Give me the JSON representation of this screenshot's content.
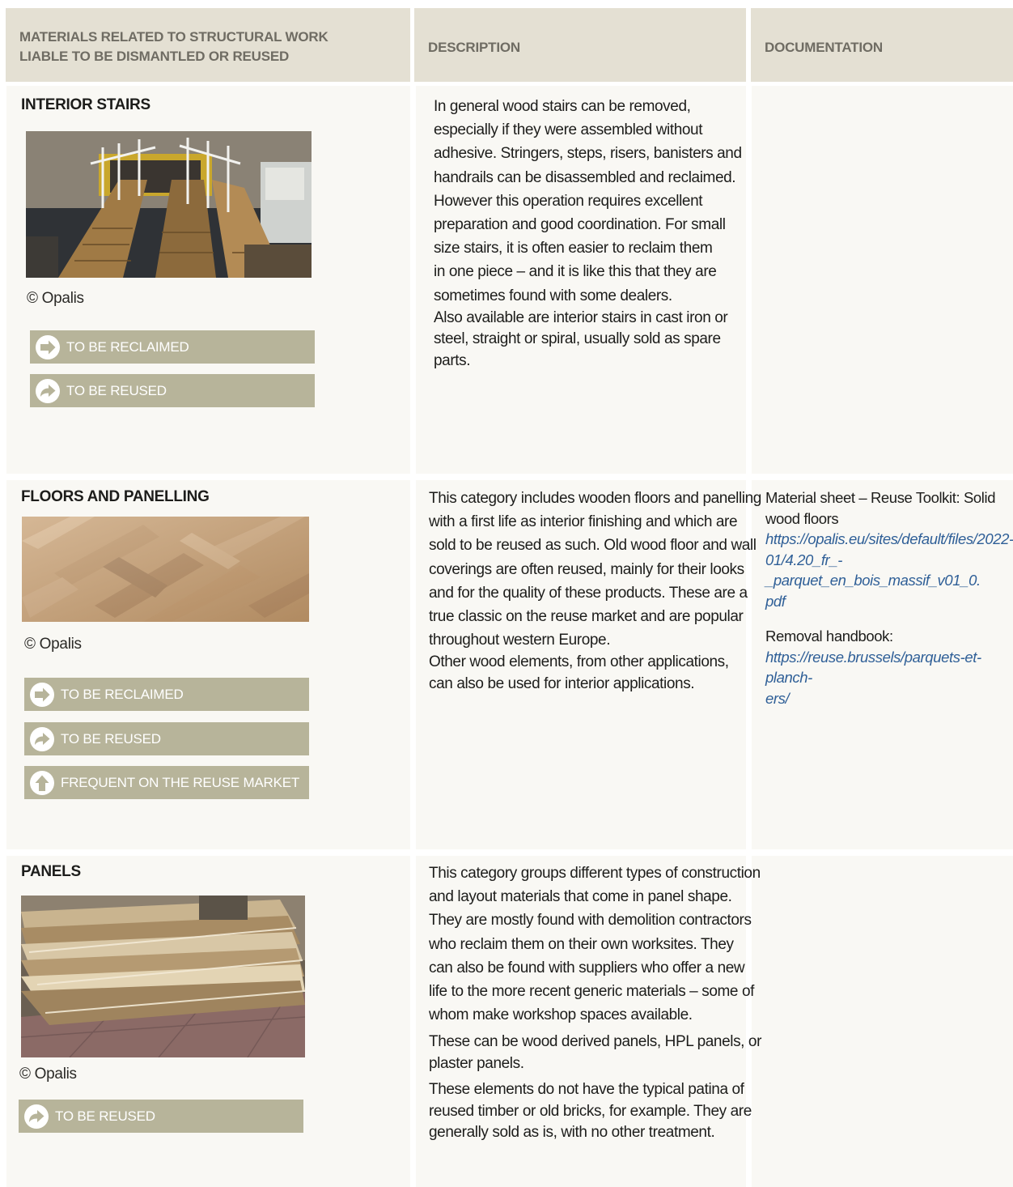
{
  "header": {
    "col1_line1": "MATERIALS RELATED TO STRUCTURAL WORK",
    "col1_line2": "LIABLE TO BE DISMANTLED OR REUSED",
    "col2": "DESCRIPTION",
    "col3": "DOCUMENTATION"
  },
  "badges": {
    "reclaimed": "TO BE RECLAIMED",
    "reused": "TO BE REUSED",
    "frequent": "FREQUENT ON THE REUSE MARKET"
  },
  "rows": [
    {
      "title": "INTERIOR STAIRS",
      "credit": "© Opalis",
      "desc": [
        "In general wood stairs can be removed,",
        "especially if they were assembled without",
        "adhesive. Stringers, steps, risers, banisters and",
        "handrails can be disassembled and reclaimed.",
        "However this operation requires excellent",
        "preparation and good coordination. For small",
        "size stairs, it is often easier to reclaim them",
        "in one piece – and it is like this that they are",
        "sometimes found with some dealers.",
        "Also available are interior stairs in cast iron or",
        "steel, straight or spiral, usually sold as spare",
        "parts."
      ]
    },
    {
      "title": "FLOORS AND PANELLING",
      "credit": "© Opalis",
      "desc": [
        "This category includes wooden floors and panelling",
        "with a first life as interior finishing and which are",
        "sold to be reused as such. Old wood floor and wall",
        "coverings are often reused, mainly for their looks",
        "and for the quality of these products. These are a",
        "true classic on the reuse market and are popular",
        "throughout western Europe.",
        "Other wood elements, from other applications,",
        "can also be used for interior applications."
      ],
      "doc": {
        "label1_line1": "Material sheet – Reuse Toolkit: Solid",
        "label1_line2": "wood floors",
        "link1_line1": "https://opalis.eu/sites/default/files/2022-",
        "link1_line2": "01/4.20_fr_-_parquet_en_bois_massif_v01_0.",
        "link1_line3": "pdf",
        "label2": "Removal handbook:",
        "link2_line1": "https://reuse.brussels/parquets-et-planch-",
        "link2_line2": "ers/"
      }
    },
    {
      "title": "PANELS",
      "credit": "© Opalis",
      "desc": [
        "This category groups different types of construction",
        "and layout materials that come in panel shape.",
        "They are mostly found with demolition contractors",
        "who reclaim them on their own worksites. They",
        "can also be found with suppliers who offer a new",
        "life to the more recent generic materials – some of",
        "whom make workshop spaces available.",
        "These can be wood derived panels, HPL panels, or",
        "plaster panels.",
        "These elements do not have the typical patina of",
        "reused timber or old bricks, for example. They are",
        "generally sold as is, with no other treatment."
      ]
    }
  ],
  "colors": {
    "header_bg": "#e4e0d3",
    "cell_bg": "#f9f8f4",
    "badge_bg": "#b7b49a",
    "link": "#2f5f97"
  },
  "icons": {
    "reclaimed": "arrow-right-circle-icon",
    "reused": "curved-arrow-right-circle-icon",
    "frequent": "arrow-up-circle-icon"
  }
}
